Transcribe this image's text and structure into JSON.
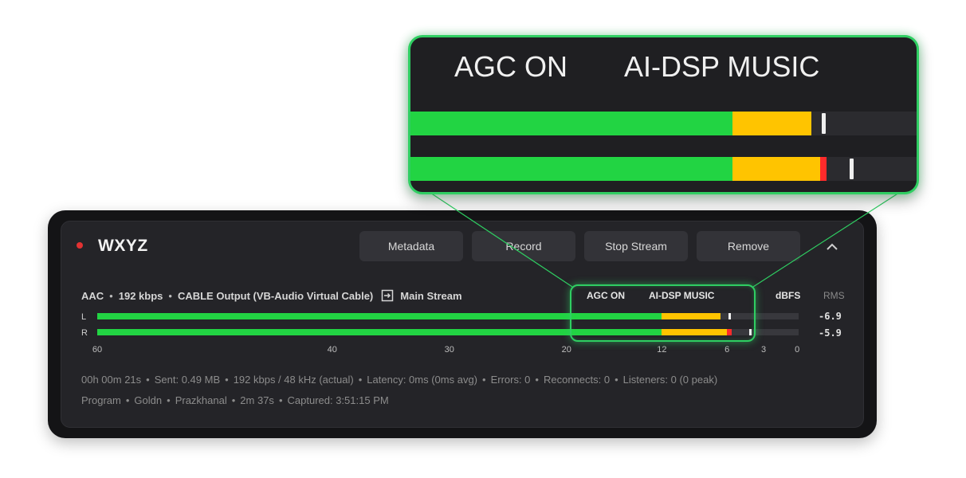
{
  "station": {
    "name": "WXYZ",
    "status_color": "#e23232"
  },
  "buttons": {
    "metadata": "Metadata",
    "record": "Record",
    "stop_stream": "Stop Stream",
    "remove": "Remove",
    "collapse_icon": "chevron-up-icon"
  },
  "stream_info": {
    "codec": "AAC",
    "bitrate": "192 kbps",
    "device": "CABLE Output (VB-Audio Virtual Cable)",
    "route_icon": "route-icon",
    "destination": "Main Stream",
    "agc": "AGC ON",
    "dsp": "AI-DSP MUSIC",
    "unit_label": "dBFS",
    "rms_label": "RMS"
  },
  "meters": [
    {
      "channel": "L",
      "rms": "-6.9",
      "green_end": 0.805,
      "yellow_end": 0.889,
      "red_end": 0.889,
      "peak": 0.9
    },
    {
      "channel": "R",
      "rms": "-5.9",
      "green_end": 0.805,
      "yellow_end": 0.898,
      "red_end": 0.905,
      "peak": 0.929
    }
  ],
  "scale": {
    "ticks": [
      "60",
      "40",
      "30",
      "20",
      "12",
      "6",
      "3",
      "0"
    ],
    "positions": [
      0,
      0.335,
      0.502,
      0.669,
      0.805,
      0.898,
      0.95,
      0.998
    ]
  },
  "stats": {
    "uptime": "00h 00m 21s",
    "sent": "Sent: 0.49 MB",
    "actual": "192 kbps / 48 kHz (actual)",
    "latency": "Latency: 0ms (0ms avg)",
    "errors": "Errors: 0",
    "reconnects": "Reconnects: 0",
    "listeners": "Listeners: 0 (0 peak)"
  },
  "program": {
    "label": "Program",
    "artist": "Goldn",
    "title": "Prazkhanal",
    "duration": "2m 37s",
    "captured": "Captured: 3:51:15 PM"
  },
  "zoom": {
    "agc": "AGC ON",
    "dsp": "AI-DSP MUSIC"
  },
  "colors": {
    "accent_green": "#2fce62",
    "meter_green": "#22d443",
    "meter_yellow": "#ffc400",
    "meter_red": "#ff2b2b"
  }
}
